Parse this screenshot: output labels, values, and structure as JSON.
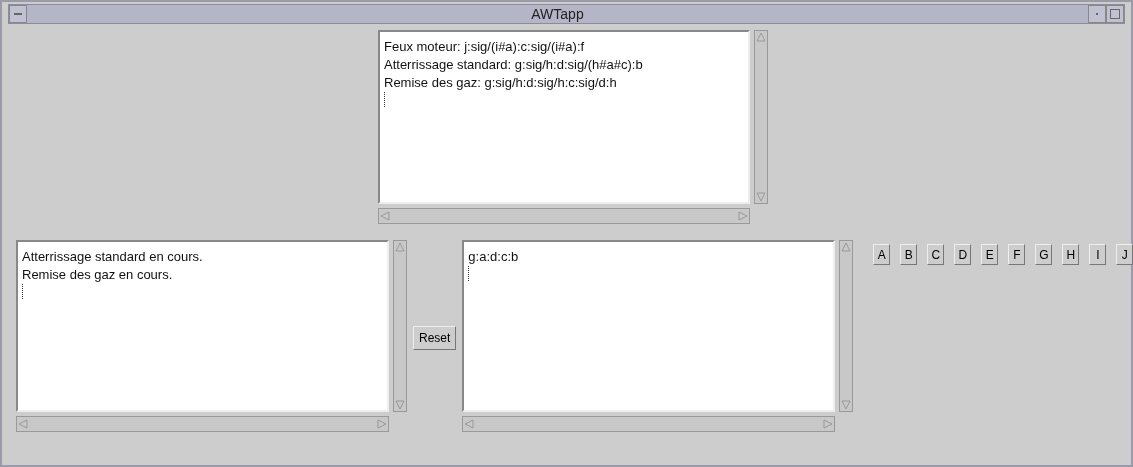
{
  "window": {
    "title": "AWTapp"
  },
  "rules_area": {
    "lines": [
      "Feux moteur: j:sig/(i#a):c:sig/(i#a):f",
      "Atterrissage standard: g:sig/h:d:sig/(h#a#c):b",
      "Remise des gaz: g:sig/h:d:sig/h:c:sig/d:h"
    ]
  },
  "status_area": {
    "lines": [
      "Atterrissage standard en cours.",
      "Remise des gaz en cours."
    ]
  },
  "reset_button": {
    "label": "Reset"
  },
  "sequence_area": {
    "lines": [
      "g:a:d:c:b"
    ]
  },
  "letter_buttons": [
    "A",
    "B",
    "C",
    "D",
    "E",
    "F",
    "G",
    "H",
    "I",
    "J"
  ]
}
